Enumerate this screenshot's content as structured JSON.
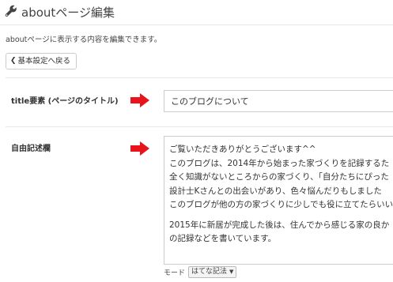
{
  "header": {
    "title": "aboutページ編集",
    "icon": "wrench-icon"
  },
  "description": "aboutページに表示する内容を編集できます。",
  "back_button": {
    "label": "基本設定へ戻る",
    "icon": "chevron-left-icon"
  },
  "title_field": {
    "label": "title要素 (ページのタイトル)",
    "value": "このブログについて"
  },
  "free_text": {
    "label": "自由記述欄",
    "lines": [
      "ご覧いただきありがとうございます^^",
      "このブログは、2014年から始まった家づくりを記録するた",
      "全く知識がないところからの家づくり、「自分たちにぴった",
      "設計士Kさんとの出会いがあり、色々悩んだりもしました",
      "このブログが他の方の家づくりに少しでも役に立てたらいい",
      "",
      "2015年に新居が完成した後は、住んでから感じる家の良か",
      "の記録などを書いています。"
    ]
  },
  "mode": {
    "label": "モード",
    "selected": "はてな記法"
  },
  "colors": {
    "arrow": "#e8131b",
    "border": "#cccccc"
  }
}
